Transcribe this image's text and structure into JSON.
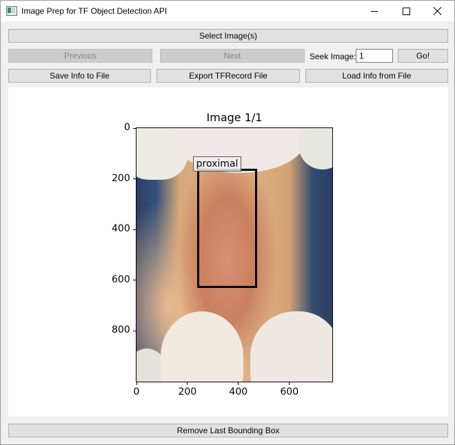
{
  "window": {
    "title": "Image Prep for TF Object Detection API"
  },
  "toolbar": {
    "select_images": "Select Image(s)",
    "previous": "Previous",
    "next": "Next",
    "seek_label": "Seek Image:",
    "seek_value": "1",
    "go": "Go!",
    "save_info": "Save Info to File",
    "export_tfrecord": "Export TFRecord File",
    "load_info": "Load Info from File",
    "remove_last_box": "Remove Last Bounding Box"
  },
  "plot": {
    "title": "Image 1/1",
    "x_range": [
      0,
      768
    ],
    "y_range": [
      0,
      1000
    ],
    "x_ticks": [
      0,
      200,
      400,
      600
    ],
    "y_ticks": [
      0,
      200,
      400,
      600,
      800
    ]
  },
  "annotations": [
    {
      "label": "proximal",
      "x_min": 237,
      "y_min": 160,
      "x_max": 472,
      "y_max": 630
    }
  ],
  "colors": {
    "window_bg": "#f0f0f0",
    "button_bg": "#e1e1e1",
    "button_disabled_bg": "#cccccc",
    "bbox": "#000000"
  },
  "icons": {
    "app": "app-icon",
    "minimize": "minimize-icon",
    "maximize": "maximize-icon",
    "close": "close-icon"
  }
}
